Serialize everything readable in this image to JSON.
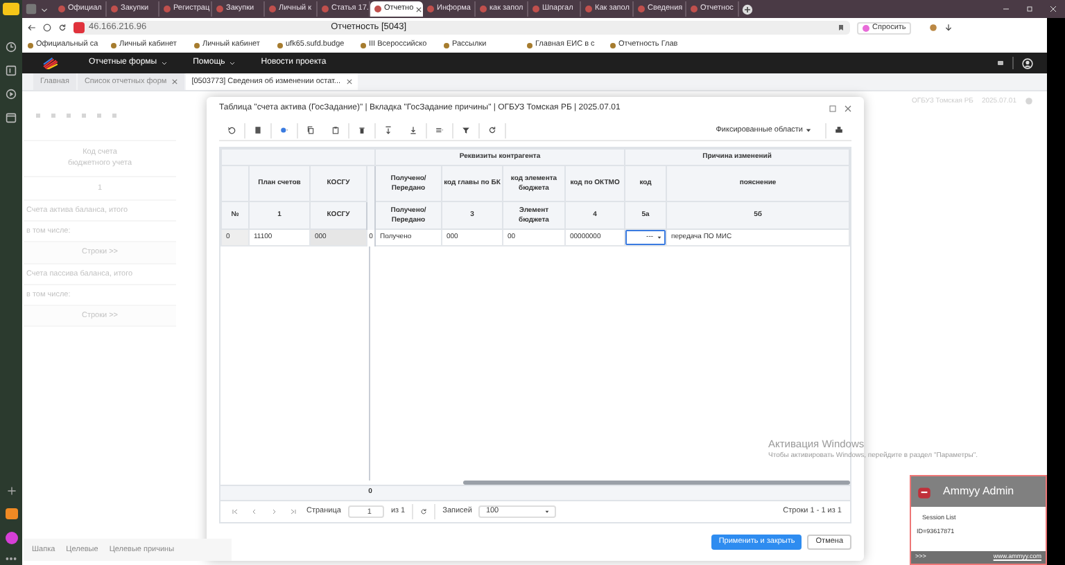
{
  "browser_tabs": [
    {
      "label": "Официал",
      "selected": false
    },
    {
      "label": "Закупки",
      "selected": false
    },
    {
      "label": "Регистрац",
      "selected": false
    },
    {
      "label": "Закупки",
      "selected": false
    },
    {
      "label": "Личный к",
      "selected": false
    },
    {
      "label": "Статья 17.",
      "selected": false
    },
    {
      "label": "Отчетно",
      "selected": true
    },
    {
      "label": "Информа",
      "selected": false
    },
    {
      "label": "как запол",
      "selected": false
    },
    {
      "label": "Шпаргал",
      "selected": false
    },
    {
      "label": "Как запол",
      "selected": false
    },
    {
      "label": "Сведения",
      "selected": false
    },
    {
      "label": "Отчетнос",
      "selected": false
    }
  ],
  "address_bar": {
    "url": "46.166.216.96",
    "page_title": "Отчетность [5043]",
    "ask_button": "Спросить"
  },
  "bookmarks": [
    "Официальный са",
    "Личный кабинет",
    "Личный кабинет",
    "ufk65.sufd.budge",
    "III Всероссийско",
    "Рассылки",
    "Главная ЕИС в с",
    "Отчетность Глав"
  ],
  "app_menu": [
    {
      "label": "Отчетные формы",
      "kind": "dropdown"
    },
    {
      "label": "Помощь",
      "kind": "dropdown"
    },
    {
      "label": "Новости проекта",
      "kind": "link"
    }
  ],
  "app_tabs": [
    {
      "label": "Главная",
      "selected": false,
      "closable": false
    },
    {
      "label": "Список отчетных форм",
      "selected": false,
      "closable": true
    },
    {
      "label": "[0503773] Сведения об изменении остат...",
      "selected": true,
      "closable": true
    }
  ],
  "background": {
    "left_rows": [
      {
        "text": "Код счета бюджетного учета",
        "kind": "header"
      },
      {
        "text": "1",
        "kind": "header"
      },
      {
        "text": "Счета актива баланса, итого",
        "kind": "row"
      },
      {
        "text": "в том числе:",
        "kind": "row"
      },
      {
        "text": "Строки >>",
        "kind": "expander"
      },
      {
        "text": "Счета пассива баланса, итого",
        "kind": "row"
      },
      {
        "text": "в том числе:",
        "kind": "row"
      },
      {
        "text": "Строки >>",
        "kind": "expander"
      }
    ],
    "bottom_tabs": [
      "Шапка",
      "Целевые",
      "Целевые причины"
    ],
    "right_header": [
      "ОГБУЗ Томская РБ",
      "2025.07.01"
    ]
  },
  "dialog": {
    "title": "Таблица \"счета актива (ГосЗадание)\" | Вкладка \"ГосЗадание причины\" | ОГБУЗ Томская РБ | 2025.07.01",
    "fixed_areas": "Фиксированные области",
    "table": {
      "group_header": [
        {
          "kind": "blank"
        },
        {
          "text": "Реквизиты контрагента",
          "kind": "group"
        },
        {
          "text": "Причина изменений",
          "kind": "group"
        }
      ],
      "columns": [
        {
          "subheader": "№"
        },
        {
          "header": "План счетов",
          "subheader": "1"
        },
        {
          "header": "КОСГУ",
          "subheader": "КОСГУ"
        },
        {
          "kind": "divider"
        },
        {
          "header": "Получено/ Передано",
          "subheader": "Получено/ Передано"
        },
        {
          "header": "код главы по БК",
          "subheader": "3"
        },
        {
          "header": "код элемента бюджета",
          "subheader": "Элемент бюджета"
        },
        {
          "header": "код по ОКТМО",
          "subheader": "4"
        },
        {
          "header": "код",
          "subheader": "5а"
        },
        {
          "header": "пояснение",
          "subheader": "5б"
        }
      ],
      "rows": [
        {
          "cells": [
            {
              "text": "0",
              "kind": "index"
            },
            {
              "text": "11100",
              "kind": "text"
            },
            {
              "text": "000",
              "kind": "readonly"
            },
            {
              "text": "0",
              "kind": "divider"
            },
            {
              "text": "Получено",
              "kind": "text"
            },
            {
              "text": "000",
              "kind": "text"
            },
            {
              "text": "00",
              "kind": "text"
            },
            {
              "text": "00000000",
              "kind": "text"
            },
            {
              "text": "---",
              "kind": "editor"
            },
            {
              "text": "передача ПО МИС",
              "kind": "text"
            }
          ]
        }
      ],
      "summary": "0"
    },
    "pager": {
      "page_label": "Страница",
      "page": "1",
      "of": "из 1",
      "records_label": "Записей",
      "records": "100",
      "summary": "Строки 1 - 1 из 1"
    },
    "buttons": [
      {
        "label": "Применить и закрыть",
        "kind": "primary"
      },
      {
        "label": "Отмена",
        "kind": "secondary"
      }
    ]
  },
  "ammyy": {
    "title": "Ammyy Admin",
    "session": "Session List",
    "id": "ID=93617871",
    "more": ">>>",
    "link": "www.ammyy.com"
  },
  "os_notice": {
    "title": "Активация Windows",
    "text": "Чтобы активировать Windows, перейдите в раздел \"Параметры\"."
  }
}
